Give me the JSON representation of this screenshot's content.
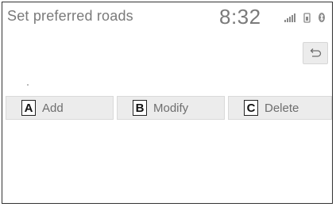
{
  "header": {
    "title": "Set preferred roads",
    "time": "8:32"
  },
  "status_icons": [
    "signal-bars-icon",
    "phone-battery-icon",
    "bluetooth-icon"
  ],
  "back_button": {
    "icon": "back-arrow-icon"
  },
  "actions": [
    {
      "key": "A",
      "label": "Add"
    },
    {
      "key": "B",
      "label": "Modify"
    },
    {
      "key": "C",
      "label": "Delete"
    }
  ],
  "colors": {
    "text": "#6e6e6e",
    "button_bg": "#ececec",
    "border": "#333333"
  }
}
